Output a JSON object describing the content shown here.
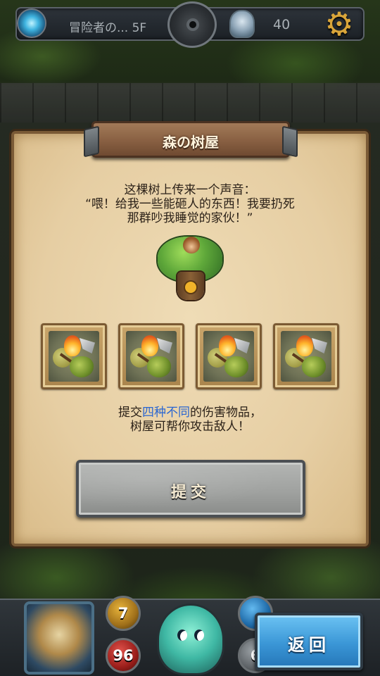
{
  "hud": {
    "floor_label": "冒险者の... 5F",
    "counter": "40"
  },
  "event": {
    "title": "森の树屋",
    "story_line1": "这棵树上传来一个声音：",
    "story_line2": "“喂！给我一些能砸人的东西！我要扔死",
    "story_line3": "那群吵我睡觉的家伙！”",
    "hint_prefix": "提交",
    "hint_highlight": "四种不同",
    "hint_suffix": "的伤害物品，",
    "hint_line2": "树屋可帮你攻击敌人！",
    "submit_label": "提交",
    "slot_count": 4
  },
  "hero": {
    "attack": "7",
    "health": "96",
    "defense": "6"
  },
  "footer": {
    "return_label": "返回"
  },
  "colors": {
    "highlight": "#2a66d1",
    "parchment": "#e6cea3",
    "return_button": "#3a96d6"
  }
}
